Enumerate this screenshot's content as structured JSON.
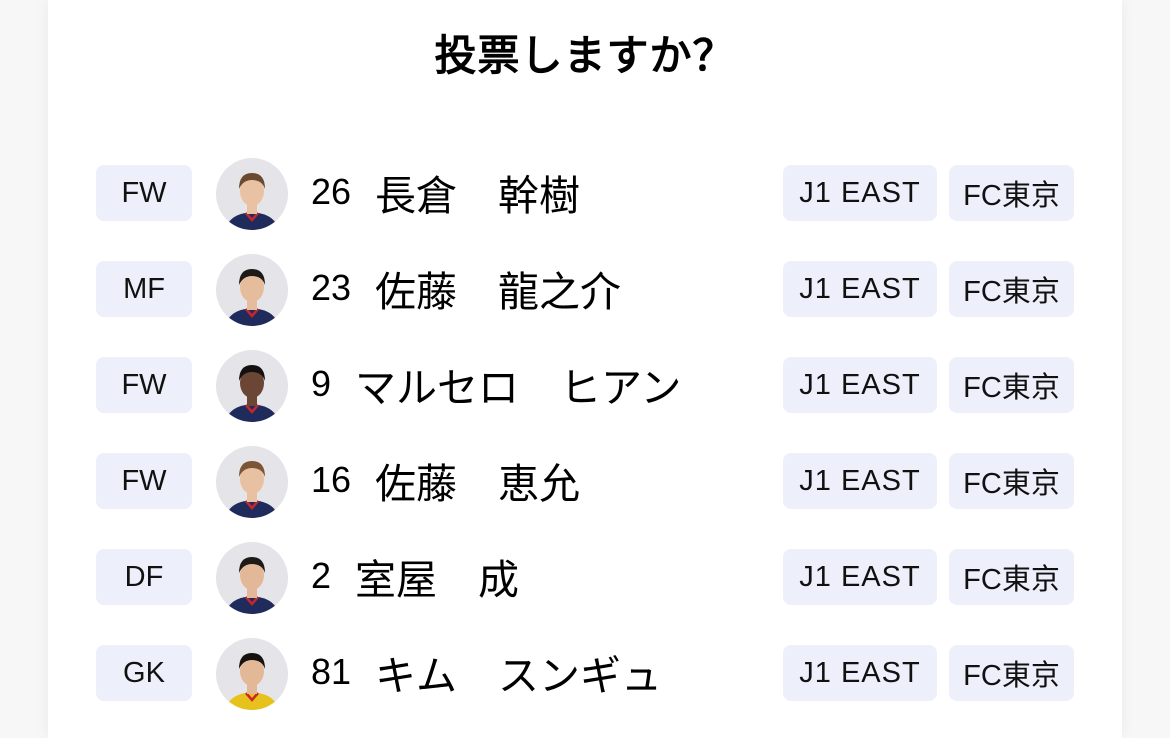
{
  "title": "投票しますか？",
  "players": [
    {
      "position": "FW",
      "number": "26",
      "name": "長倉　幹樹",
      "league": "J1 EAST",
      "club": "FC東京",
      "kit_color": "#1f2b5a"
    },
    {
      "position": "MF",
      "number": "23",
      "name": "佐藤　龍之介",
      "league": "J1 EAST",
      "club": "FC東京",
      "kit_color": "#1f2b5a"
    },
    {
      "position": "FW",
      "number": "9",
      "name": "マルセロ　ヒアン",
      "league": "J1 EAST",
      "club": "FC東京",
      "kit_color": "#1f2b5a"
    },
    {
      "position": "FW",
      "number": "16",
      "name": "佐藤　恵允",
      "league": "J1 EAST",
      "club": "FC東京",
      "kit_color": "#1f2b5a"
    },
    {
      "position": "DF",
      "number": "2",
      "name": "室屋　成",
      "league": "J1 EAST",
      "club": "FC東京",
      "kit_color": "#1f2b5a"
    },
    {
      "position": "GK",
      "number": "81",
      "name": "キム　スンギュ",
      "league": "J1 EAST",
      "club": "FC東京",
      "kit_color": "#e8c21c"
    }
  ],
  "colors": {
    "badge_bg": "#edf0fb",
    "avatar_bg": "#e4e4e9",
    "accent_stripe": "#c8252f"
  }
}
